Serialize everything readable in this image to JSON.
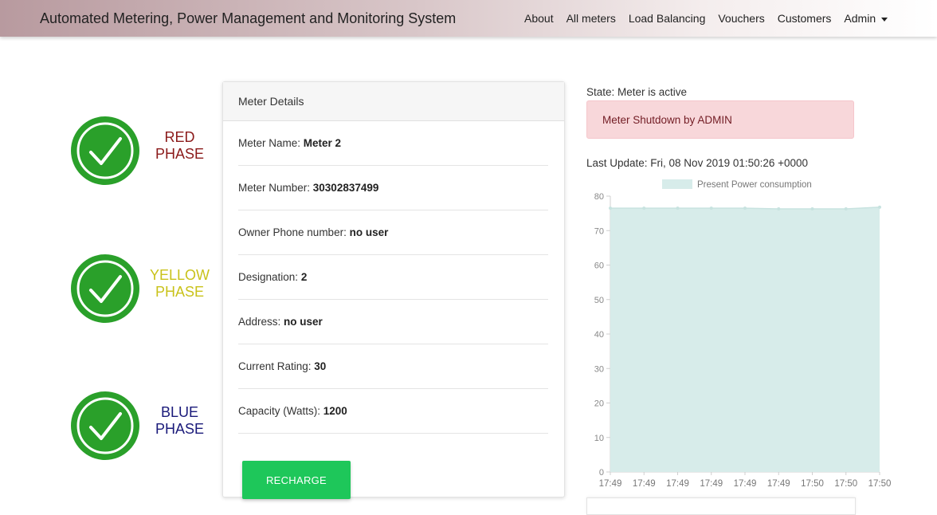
{
  "navbar": {
    "brand": "Automated Metering, Power Management and Monitoring System",
    "links": [
      "About",
      "All meters",
      "Load Balancing",
      "Vouchers",
      "Customers"
    ],
    "admin": "Admin"
  },
  "phases": [
    {
      "label_line1": "RED",
      "label_line2": "PHASE",
      "color": "#8b1a1a",
      "status": "ok"
    },
    {
      "label_line1": "YELLOW",
      "label_line2": "PHASE",
      "color": "#c9c21a",
      "status": "ok"
    },
    {
      "label_line1": "BLUE",
      "label_line2": "PHASE",
      "color": "#1a1a7a",
      "status": "ok"
    }
  ],
  "meter_card": {
    "header": "Meter Details",
    "rows": [
      {
        "label": "Meter Name: ",
        "value": "Meter 2"
      },
      {
        "label": "Meter Number: ",
        "value": "30302837499"
      },
      {
        "label": "Owner Phone number: ",
        "value": "no user"
      },
      {
        "label": "Designation: ",
        "value": "2"
      },
      {
        "label": "Address: ",
        "value": "no user"
      },
      {
        "label": "Current Rating: ",
        "value": "30"
      },
      {
        "label": "Capacity (Watts): ",
        "value": "1200"
      }
    ],
    "recharge_label": "RECHARGE"
  },
  "status": {
    "state": "State: Meter is active",
    "alert": "Meter Shutdown by ADMIN",
    "last_update": "Last Update: Fri, 08 Nov 2019 01:50:26 +0000"
  },
  "colors": {
    "check_green": "#2aa02a",
    "alert_bg": "#f8d7da",
    "recharge": "#1ec75a",
    "area_fill": "#d7ecea"
  },
  "chart_data": {
    "type": "area",
    "x": [
      "17:49",
      "17:49",
      "17:49",
      "17:49",
      "17:49",
      "17:49",
      "17:50",
      "17:50",
      "17:50"
    ],
    "series": [
      {
        "name": "Present Power consumption",
        "values": [
          76.5,
          76.5,
          76.5,
          76.5,
          76.5,
          76.3,
          76.3,
          76.3,
          76.8
        ]
      }
    ],
    "yticks": [
      0,
      10,
      20,
      30,
      40,
      50,
      60,
      70,
      80
    ],
    "ylim": [
      0,
      80
    ],
    "legend": "top-center",
    "grid": false
  }
}
